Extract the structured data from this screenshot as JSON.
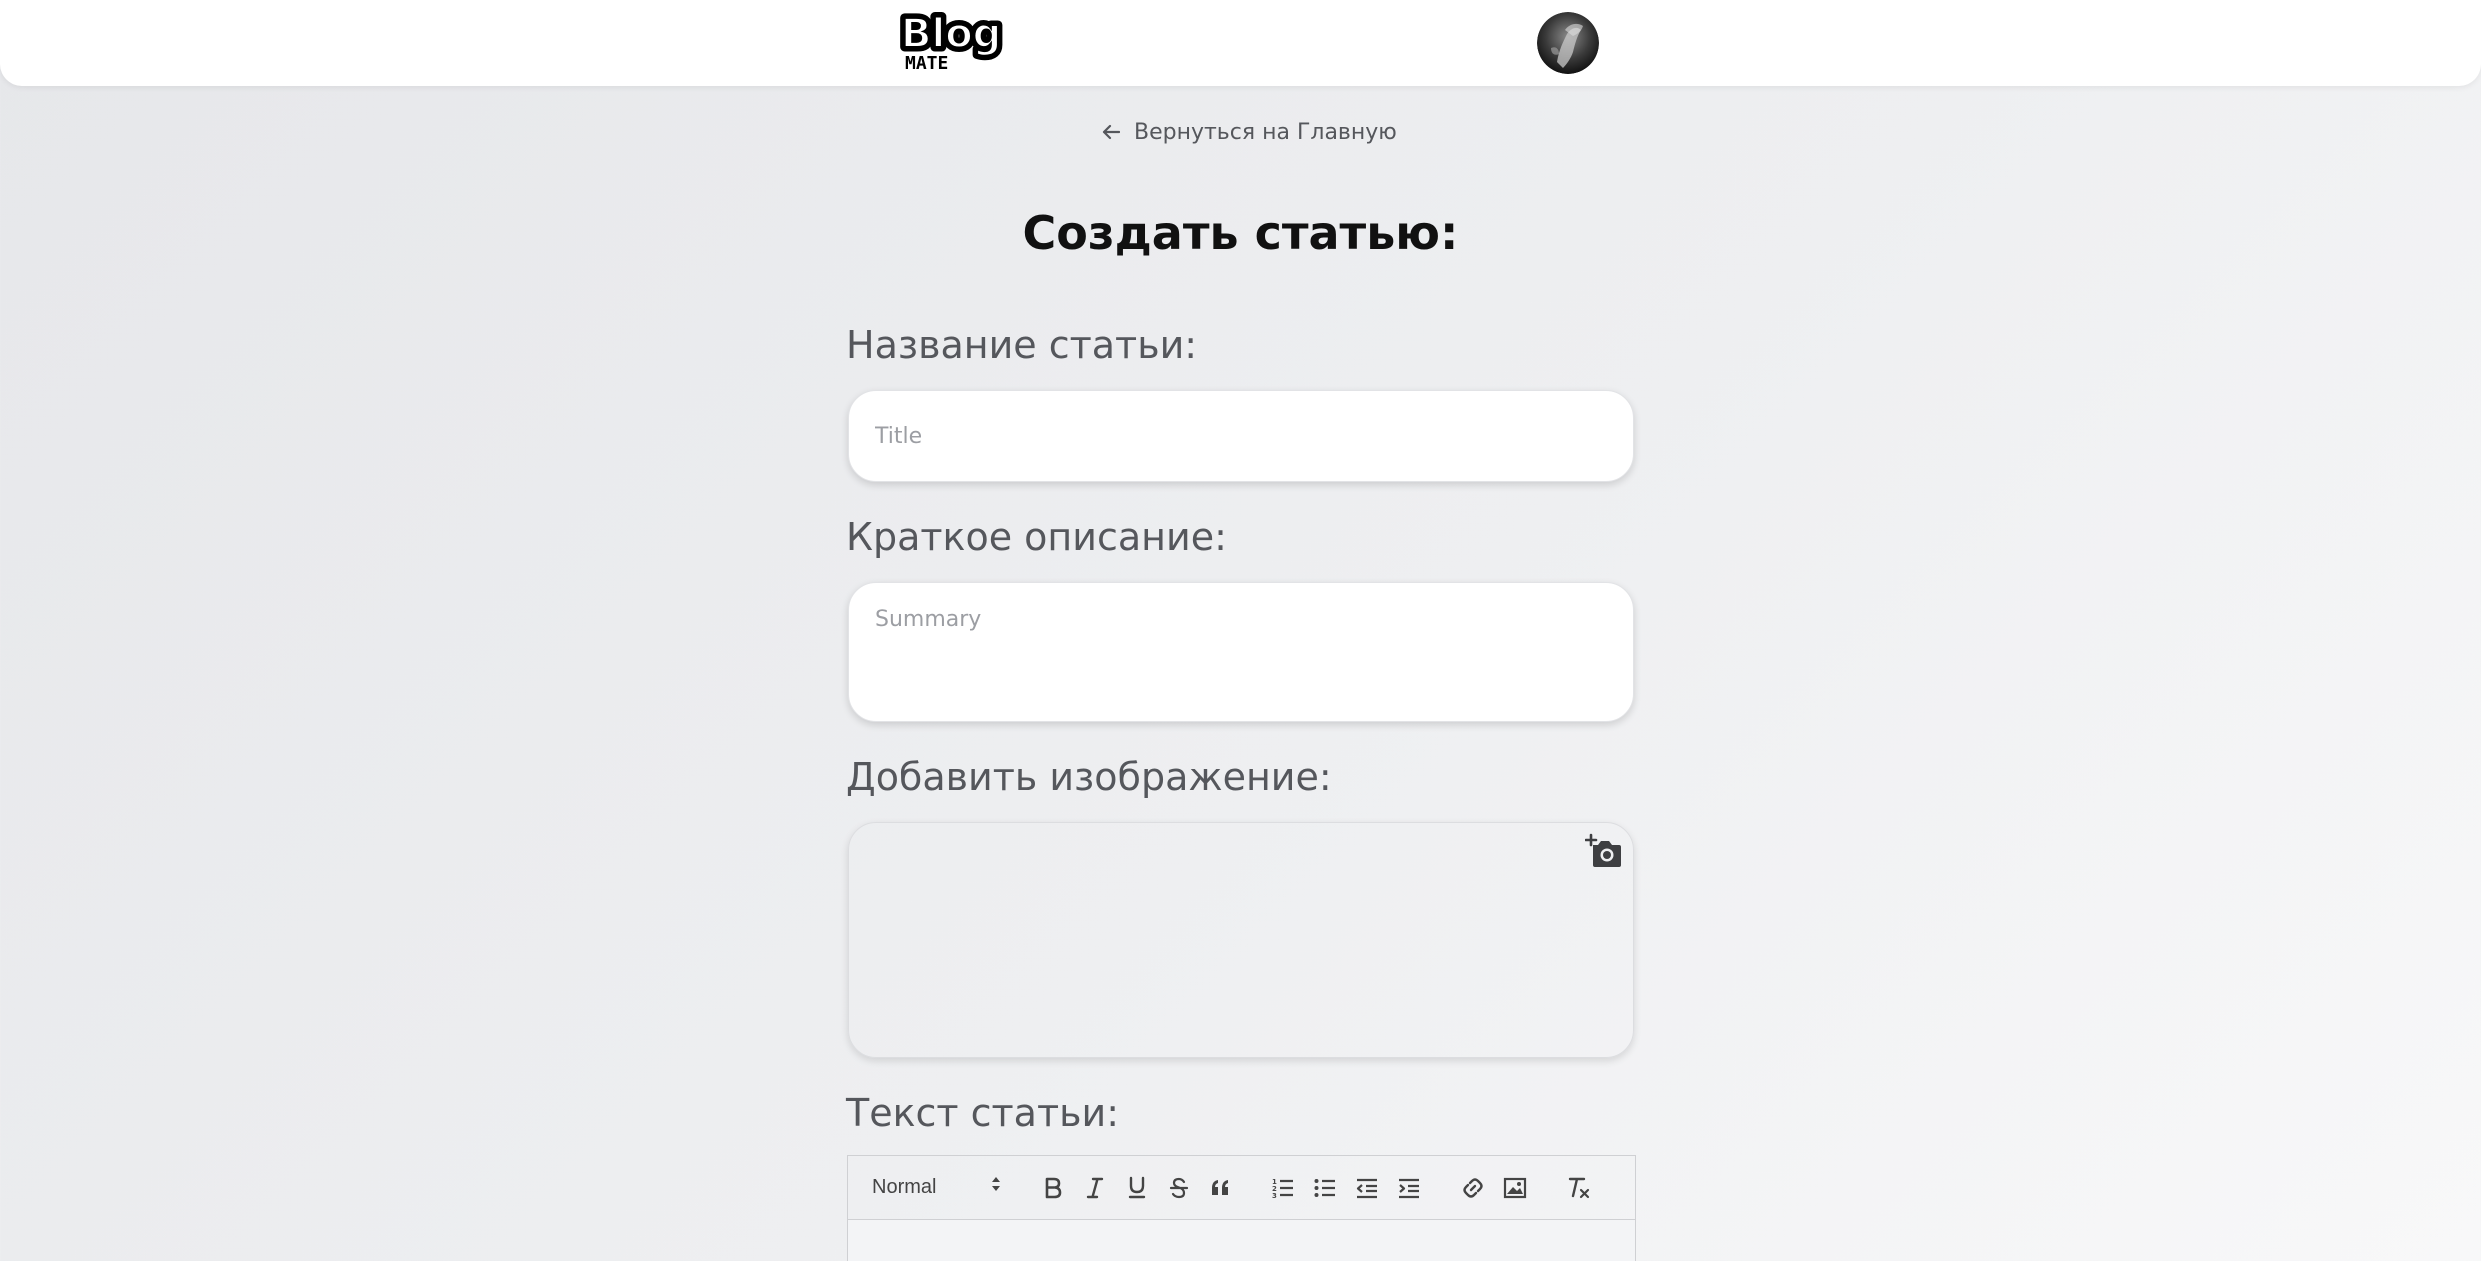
{
  "header": {
    "logo_text_top": "Blog",
    "logo_text_bottom": "MATE"
  },
  "back_link": {
    "label": "Вернуться на Главную"
  },
  "page": {
    "title": "Создать статью:"
  },
  "form": {
    "title_label": "Название статьи:",
    "title_placeholder": "Title",
    "summary_label": "Краткое описание:",
    "summary_placeholder": "Summary",
    "image_label": "Добавить изображение:",
    "text_label": "Текст статьи:"
  },
  "editor": {
    "format_value": "Normal",
    "toolbar_icons": [
      "bold-icon",
      "italic-icon",
      "underline-icon",
      "strikethrough-icon",
      "blockquote-icon",
      "ordered-list-icon",
      "bullet-list-icon",
      "outdent-icon",
      "indent-icon",
      "link-icon",
      "image-icon",
      "clear-format-icon"
    ]
  },
  "colors": {
    "label_text": "#55575c",
    "title_text": "#111111",
    "placeholder": "#9c9ea3"
  }
}
